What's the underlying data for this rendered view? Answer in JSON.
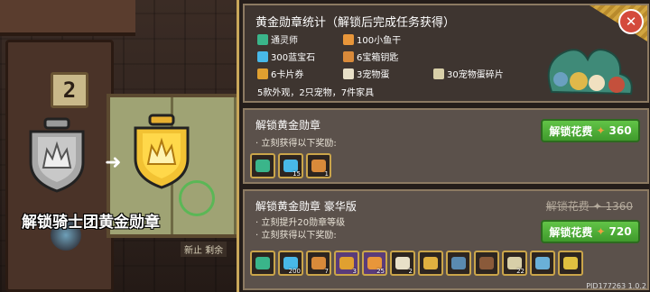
{
  "scene": {
    "plate_number": "2",
    "caption": "解锁骑士团黄金勋章",
    "sell_tag": "新止 剩余",
    "arrow": "➜"
  },
  "summary": {
    "title": "黄金勋章统计（解锁后完成任务获得）",
    "items": [
      {
        "label": "通灵师",
        "color": "#3ab58a"
      },
      {
        "label": "100小鱼干",
        "color": "#e8963a"
      },
      {
        "label": "",
        "color": ""
      },
      {
        "label": "300蓝宝石",
        "color": "#48b8e8"
      },
      {
        "label": "6宝箱钥匙",
        "color": "#d98a3a"
      },
      {
        "label": "",
        "color": ""
      },
      {
        "label": "6卡片券",
        "color": "#e0a030"
      },
      {
        "label": "3宠物蛋",
        "color": "#e8e0c8"
      },
      {
        "label": "30宠物蛋碎片",
        "color": "#d8cfa8"
      }
    ],
    "footer": "5款外观，2只宠物，7件家具",
    "close": "✕"
  },
  "basic": {
    "title": "解锁黄金勋章",
    "subtitle": "立刻获得以下奖励:",
    "price_label": "解锁花费",
    "price": "360",
    "rewards": [
      {
        "name": "medal-reward-icon",
        "qty": "",
        "color": "#3ab58a"
      },
      {
        "name": "gem-reward-icon",
        "qty": "15",
        "color": "#48b8e8"
      },
      {
        "name": "key-reward-icon",
        "qty": "1",
        "color": "#d98a3a"
      }
    ]
  },
  "deluxe": {
    "title": "解锁黄金勋章 豪华版",
    "subtitle1": "立刻提升20勋章等级",
    "subtitle2": "立刻获得以下奖励:",
    "old_price_label": "解锁花费",
    "old_price": "1360",
    "price_label": "解锁花费",
    "price": "720",
    "rewards": [
      {
        "name": "medal-reward-icon",
        "qty": "",
        "color": "#3ab58a",
        "purple": false
      },
      {
        "name": "gem-reward-icon",
        "qty": "200",
        "color": "#48b8e8",
        "purple": false
      },
      {
        "name": "key-reward-icon",
        "qty": "7",
        "color": "#d98a3a",
        "purple": false
      },
      {
        "name": "ticket-reward-icon",
        "qty": "3",
        "color": "#e0a030",
        "purple": true
      },
      {
        "name": "fish-reward-icon",
        "qty": "25",
        "color": "#e8963a",
        "purple": true
      },
      {
        "name": "egg-reward-icon",
        "qty": "2",
        "color": "#e8e0c8",
        "purple": false
      },
      {
        "name": "crown-reward-icon",
        "qty": "",
        "color": "#e0b040",
        "purple": false
      },
      {
        "name": "jar-reward-icon",
        "qty": "",
        "color": "#5a8ab0",
        "purple": false
      },
      {
        "name": "barrel-reward-icon",
        "qty": "",
        "color": "#8a5a3a",
        "purple": false
      },
      {
        "name": "egg-shard-reward-icon",
        "qty": "22",
        "color": "#d8cfa8",
        "purple": false
      },
      {
        "name": "frame-reward-icon",
        "qty": "",
        "color": "#6ab0d8",
        "purple": false
      },
      {
        "name": "dragon-reward-icon",
        "qty": "",
        "color": "#e0c040",
        "purple": false
      }
    ]
  },
  "footer": {
    "pid": "PID177263 1.0.2"
  },
  "colors": {
    "accent_gold": "#c9a75a",
    "button_green": "#4fae36",
    "close_red": "#d44a3c"
  }
}
